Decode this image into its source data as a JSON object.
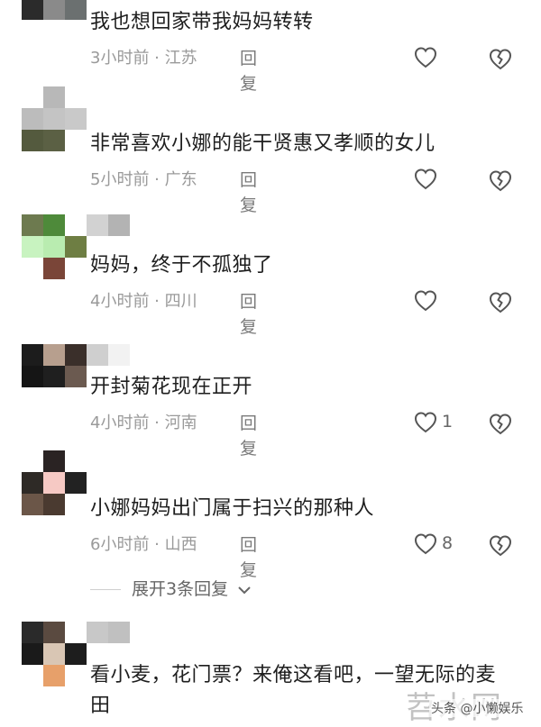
{
  "comments": [
    {
      "text": "我也想回家带我妈妈转转",
      "time": "3小时前",
      "location": "江苏",
      "reply": "回复",
      "likes": ""
    },
    {
      "text": "非常喜欢小娜的能干贤惠又孝顺的女儿",
      "time": "5小时前",
      "location": "广东",
      "reply": "回复",
      "likes": ""
    },
    {
      "text": "妈妈，终于不孤独了",
      "time": "4小时前",
      "location": "四川",
      "reply": "回复",
      "likes": ""
    },
    {
      "text": "开封菊花现在正开",
      "time": "4小时前",
      "location": "河南",
      "reply": "回复",
      "likes": "1"
    },
    {
      "text": "小娜妈妈出门属于扫兴的那种人",
      "time": "6小时前",
      "location": "山西",
      "reply": "回复",
      "likes": "8"
    },
    {
      "text": "看小麦，花门票？来俺这看吧，一望无际的麦田",
      "time": "",
      "location": "",
      "reply": "",
      "likes": ""
    }
  ],
  "expand_replies": {
    "label": "展开3条回复"
  },
  "separator": " · ",
  "watermark": {
    "logo": "苕水网",
    "byline": "头条 @小懒娱乐"
  },
  "colors": {
    "text": "#1e1e1e",
    "meta": "#9a9a9a",
    "icon": "#555555"
  },
  "icons": [
    "heart-outline-icon",
    "broken-heart-icon",
    "chevron-down-icon"
  ]
}
